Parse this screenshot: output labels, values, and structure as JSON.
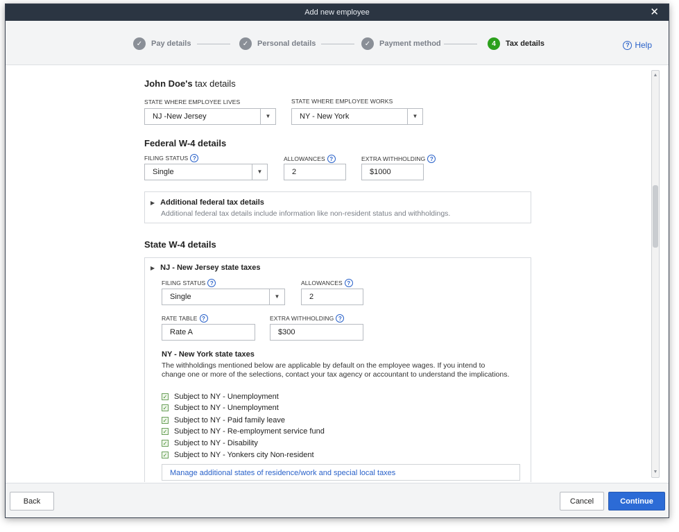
{
  "window": {
    "title": "Add new employee",
    "close_glyph": "✕"
  },
  "stepper": {
    "steps": [
      {
        "label": "Pay details",
        "badge": "✓"
      },
      {
        "label": "Personal details",
        "badge": "✓"
      },
      {
        "label": "Payment method",
        "badge": "✓"
      },
      {
        "label": "Tax details",
        "badge": "4"
      }
    ],
    "help_label": "Help"
  },
  "tax": {
    "employee_name": "John Doe's",
    "title_suffix": " tax details",
    "state_lives_label": "STATE WHERE EMPLOYEE LIVES",
    "state_lives_value": "NJ -New Jersey",
    "state_works_label": "STATE WHERE EMPLOYEE WORKS",
    "state_works_value": "NY - New York"
  },
  "federal": {
    "title": "Federal W-4 details",
    "filing_status_label": "FILING STATUS",
    "filing_status_value": "Single",
    "allowances_label": "ALLOWANCES",
    "allowances_value": "2",
    "extra_withholding_label": "EXTRA WITHHOLDING",
    "extra_withholding_value": "$1000",
    "additional_title": "Additional federal tax details",
    "additional_desc": "Additional federal tax details include information like non-resident status and withholdings."
  },
  "state": {
    "title": "State W-4 details",
    "nj_title": "NJ - New Jersey state taxes",
    "nj_filing_status_label": "FILING STATUS",
    "nj_filing_status_value": "Single",
    "nj_allowances_label": "ALLOWANCES",
    "nj_allowances_value": "2",
    "nj_rate_table_label": "RATE TABLE",
    "nj_rate_table_value": "Rate A",
    "nj_extra_withholding_label": "EXTRA WITHHOLDING",
    "nj_extra_withholding_value": "$300",
    "ny_title": "NY - New York state taxes",
    "ny_desc_line1": "The withholdings mentioned below are applicable by default on the employee wages. If you intend to",
    "ny_desc_line2": "change one or more of the selections, contact your tax agency or accountant to understand the implications.",
    "ny_checks": [
      {
        "label": "Subject to NY - Unemployment",
        "checked": true
      },
      {
        "label": "Subject to NY - Unemployment",
        "checked": true
      },
      {
        "label": "Subject to NY - Paid family leave",
        "checked": true
      },
      {
        "label": "Subject to NY - Re-employment service fund",
        "checked": true
      },
      {
        "label": "Subject to NY - Disability",
        "checked": true
      },
      {
        "label": "Subject to NY - Yonkers city Non-resident",
        "checked": true
      }
    ],
    "manage_link": "Manage additional states of residence/work and special local taxes"
  },
  "footer": {
    "back_label": "Back",
    "cancel_label": "Cancel",
    "continue_label": "Continue"
  },
  "colors": {
    "accent": "#2c6bd6",
    "active_step": "#2ca01c",
    "titlebar": "#2b3542"
  }
}
